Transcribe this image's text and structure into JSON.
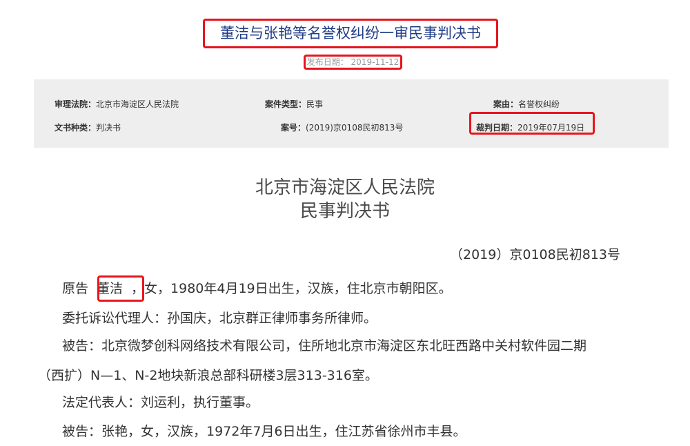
{
  "header": {
    "title": "董洁与张艳等名誉权纠纷一审民事判决书",
    "publish_date": "发布日期： 2019-11-12"
  },
  "info": {
    "court_label": "审理法院：",
    "court_value": "北京市海淀区人民法院",
    "case_type_label": "案件类型：",
    "case_type_value": "民事",
    "cause_label": "案由：",
    "cause_value": "名誉权纠纷",
    "doc_type_label": "文书种类：",
    "doc_type_value": "判决书",
    "case_no_label": "案号：",
    "case_no_value": "(2019)京0108民初813号",
    "judge_date_label": "裁判日期：",
    "judge_date_value": "2019年07月19日"
  },
  "body": {
    "court_name": "北京市海淀区人民法院",
    "doc_title": "民事判决书",
    "case_number": "（2019）京0108民初813号",
    "plaintiff_label": "原告",
    "plaintiff_name": "董洁",
    "plaintiff_rest": "，女，1980年4月19日出生，汉族，住北京市朝阳区。",
    "agent": "委托诉讼代理人：孙国庆，北京群正律师事务所律师。",
    "defendant1_line1": "被告：北京微梦创科网络技术有限公司，住所地北京市海淀区东北旺西路中关村软件园二期",
    "defendant1_line2": "（西扩）N—1、N-2地块新浪总部科研楼3层313-316室。",
    "legal_rep": "法定代表人：刘运利，执行董事。",
    "defendant2": "被告：张艳，女，汉族，1972年7月6日出生，住江苏省徐州市丰县。"
  },
  "colors": {
    "highlight": "#e8141c",
    "title": "#1f3c88",
    "panel": "#eeeeee"
  }
}
